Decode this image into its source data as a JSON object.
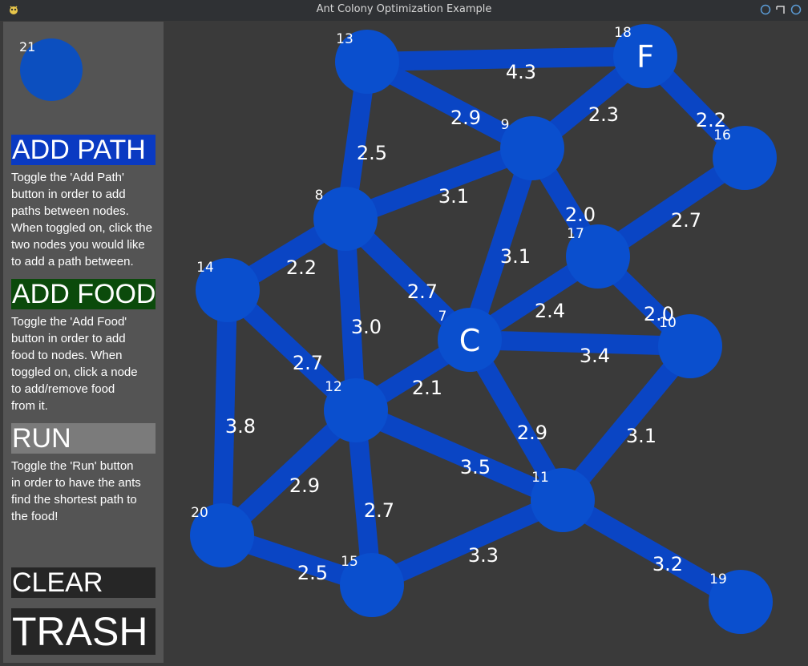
{
  "window": {
    "title": "Ant Colony Optimization Example"
  },
  "sidebar": {
    "preview_node": {
      "id": "21"
    },
    "add_path": {
      "label": "ADD PATH",
      "bg": "#0a3ac2",
      "description": [
        "Toggle the 'Add Path'",
        "button in order to add",
        "paths between nodes.",
        "When toggled on, click the",
        "two nodes you would like",
        "to add a path between."
      ]
    },
    "add_food": {
      "label": "ADD FOOD",
      "bg": "#0b4a0b",
      "description": [
        "Toggle the 'Add Food'",
        "button in order to add",
        "food to nodes. When",
        "toggled on, click a node",
        "to add/remove food",
        "from it."
      ]
    },
    "run": {
      "label": "RUN",
      "bg": "#7b7b7b",
      "description": [
        "Toggle the 'Run' button",
        "in order to have the ants",
        "find the shortest path to",
        "the food!"
      ]
    },
    "clear": {
      "label": "CLEAR",
      "bg": "#262626"
    },
    "trash": {
      "label": "TRASH",
      "bg": "#262626"
    }
  },
  "graph": {
    "node_color": "#0a4fce",
    "edge_color": "#0a45c4",
    "nodes": [
      {
        "id": "13",
        "letter": ""
      },
      {
        "id": "18",
        "letter": "F"
      },
      {
        "id": "9",
        "letter": ""
      },
      {
        "id": "16",
        "letter": ""
      },
      {
        "id": "8",
        "letter": ""
      },
      {
        "id": "17",
        "letter": ""
      },
      {
        "id": "14",
        "letter": ""
      },
      {
        "id": "7",
        "letter": "C"
      },
      {
        "id": "10",
        "letter": ""
      },
      {
        "id": "12",
        "letter": ""
      },
      {
        "id": "11",
        "letter": ""
      },
      {
        "id": "20",
        "letter": ""
      },
      {
        "id": "15",
        "letter": ""
      },
      {
        "id": "19",
        "letter": ""
      }
    ],
    "edges": [
      {
        "from": "13",
        "to": "18",
        "weight": "4.3"
      },
      {
        "from": "13",
        "to": "9",
        "weight": "2.9"
      },
      {
        "from": "13",
        "to": "8",
        "weight": "2.5"
      },
      {
        "from": "18",
        "to": "9",
        "weight": "2.3"
      },
      {
        "from": "18",
        "to": "16",
        "weight": "2.2"
      },
      {
        "from": "9",
        "to": "8",
        "weight": "3.1"
      },
      {
        "from": "9",
        "to": "17",
        "weight": "2.0"
      },
      {
        "from": "9",
        "to": "7",
        "weight": "3.1"
      },
      {
        "from": "16",
        "to": "17",
        "weight": "2.7"
      },
      {
        "from": "8",
        "to": "14",
        "weight": "2.2"
      },
      {
        "from": "8",
        "to": "7",
        "weight": "2.7"
      },
      {
        "from": "8",
        "to": "12",
        "weight": "3.0"
      },
      {
        "from": "17",
        "to": "7",
        "weight": "2.4"
      },
      {
        "from": "17",
        "to": "10",
        "weight": "2.0"
      },
      {
        "from": "7",
        "to": "10",
        "weight": "3.4"
      },
      {
        "from": "7",
        "to": "12",
        "weight": "2.1"
      },
      {
        "from": "7",
        "to": "11",
        "weight": "2.9"
      },
      {
        "from": "14",
        "to": "12",
        "weight": "2.7"
      },
      {
        "from": "14",
        "to": "20",
        "weight": "3.8"
      },
      {
        "from": "10",
        "to": "11",
        "weight": "3.1"
      },
      {
        "from": "12",
        "to": "11",
        "weight": "3.5"
      },
      {
        "from": "12",
        "to": "20",
        "weight": "2.9"
      },
      {
        "from": "12",
        "to": "15",
        "weight": "2.7"
      },
      {
        "from": "20",
        "to": "15",
        "weight": "2.5"
      },
      {
        "from": "15",
        "to": "11",
        "weight": "3.3"
      },
      {
        "from": "11",
        "to": "19",
        "weight": "3.2"
      }
    ]
  }
}
